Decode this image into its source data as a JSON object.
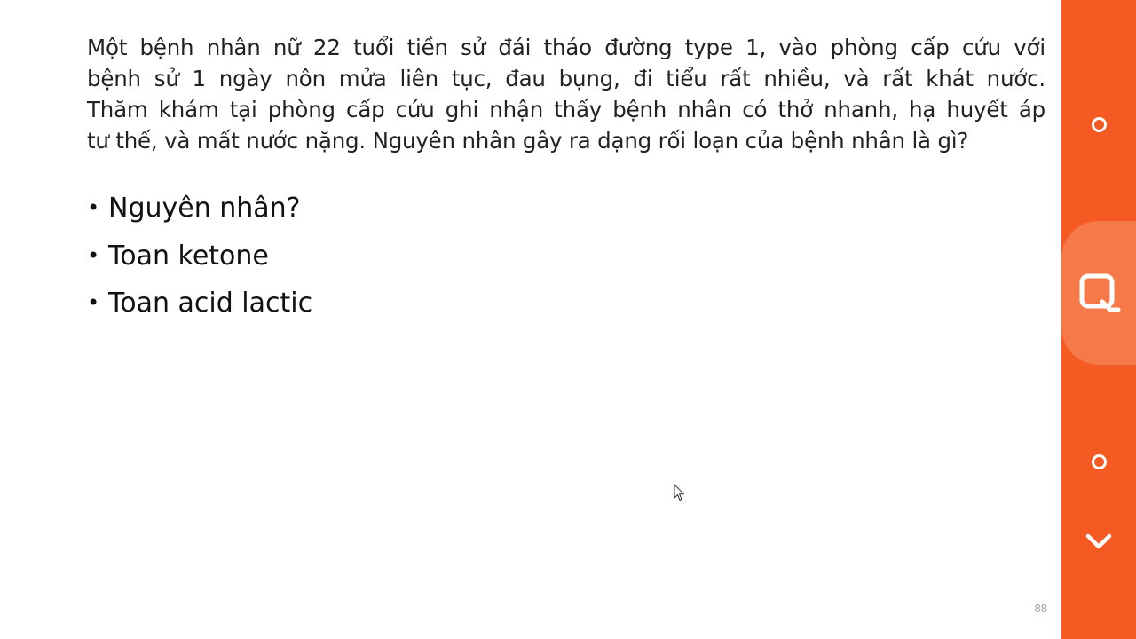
{
  "slide": {
    "question_lines": [
      "Một bệnh nhân nữ 22 tuổi tiền sử đái tháo đường type 1, vào phòng cấp cứu với",
      "bệnh sử 1 ngày nôn mửa liên tục, đau bụng, đi tiểu rất nhiều, và rất khát nước.",
      "Thăm khám tại phòng cấp cứu ghi nhận thấy bệnh nhân có thở nhanh, hạ huyết áp",
      "tư thế, và mất nước nặng. Nguyên nhân gây ra dạng rối loạn của bệnh nhân là gì?"
    ],
    "bullets": [
      "Nguyên nhân?",
      "Toan ketone",
      "Toan acid lactic"
    ],
    "page_number": "88"
  },
  "side_panel": {
    "background": "#f45a22",
    "highlight": "#f6794a",
    "controls": {
      "top": "circle-icon",
      "middle": "search-icon",
      "bottom": "circle-icon",
      "last": "chevron-down-icon"
    }
  }
}
